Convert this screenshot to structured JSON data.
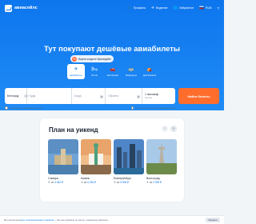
{
  "header": {
    "logo_text": "авиасейлс",
    "nav": [
      {
        "icon": "user-icon",
        "glyph": "👤",
        "label": "Профиль"
      },
      {
        "icon": "plane-icon",
        "glyph": "✈",
        "label": "Ведение"
      },
      {
        "icon": "globe-icon",
        "glyph": "🌐",
        "label": "Избранное"
      },
      {
        "icon": "flag-icon",
        "glyph": "🇷🇺",
        "label": "RUB"
      },
      {
        "icon": "help-icon",
        "glyph": "?",
        "label": ""
      }
    ]
  },
  "hero": {
    "headline": "Тут покупают дешёвые авиабилеты",
    "promo": "Ищете когда не бронируйте",
    "tabs": [
      {
        "icon": "plane-icon",
        "glyph": "✈",
        "label": "Авиабилеты",
        "active": true
      },
      {
        "icon": "hotel-icon",
        "glyph": "🛏",
        "label": "Отели",
        "active": false
      },
      {
        "icon": "car-icon",
        "glyph": "🚗",
        "label": "Автопрокат",
        "active": false
      },
      {
        "icon": "bus-icon",
        "glyph": "🚌",
        "label": "Маршруты",
        "active": false
      },
      {
        "icon": "tent-icon",
        "glyph": "⛺",
        "label": "Для бизнеса",
        "active": false
      }
    ]
  },
  "search": {
    "from": "Белгород",
    "to": "Куда",
    "depart": "Когда",
    "return": "Обратно",
    "passengers": "1 пассажир",
    "class": "эконом",
    "find_button": "Найти билеты",
    "compare_check": "Составить сложный маршрут",
    "hotel_check": "Открыть Островок в новой вкладке"
  },
  "weekend": {
    "title": "План на уикенд",
    "cards": [
      {
        "city": "Самара",
        "prefix": "от ",
        "price": "4 542 ₽"
      },
      {
        "city": "Казань",
        "prefix": "от ",
        "price": "6 333 ₽"
      },
      {
        "city": "Екатеринбург",
        "prefix": "от ",
        "price": "5 909 ₽"
      },
      {
        "city": "Волгоград",
        "prefix": "от ",
        "price": "2 939 ₽"
      }
    ]
  },
  "cookie": {
    "prefix": "Мы используем ",
    "link": "для персонализации сервисов",
    "suffix": " — без них сервисы не смогут нормально работать",
    "ok": "Хорошо"
  },
  "colors": {
    "hero": "#0d76ee",
    "accent": "#ff6d2d",
    "price": "#0d76ee"
  }
}
